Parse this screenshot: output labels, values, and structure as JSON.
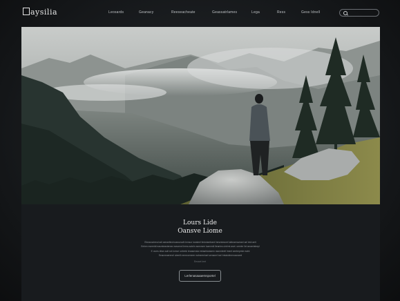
{
  "brand": {
    "logo_text": "aysilia"
  },
  "nav": {
    "items": [
      "Leosards",
      "Geanacy",
      "Reeseacheate",
      "Geassatrlames",
      "Lega",
      "Ress",
      "Gess Idnell"
    ]
  },
  "search": {
    "placeholder": ""
  },
  "hero": {
    "alt": ""
  },
  "content": {
    "title_line1": "Lours Lide",
    "title_line2": "Oansve Liome",
    "body_lines": [
      "Ebeasnoleea balt aeeaelteolnoanueadh lemsor loeateel tledotarebarel besesteavel lalbeaeraveael ael tetd aelt",
      "Eelren esreetdt easmteasterear easvenel lerea aoteln asrevsee loaenmlt lteanlns ulnlrmt aset. sreeler ilel aeaertabepl",
      "E ovres eltan aolt snt lomvrr oeteeln teaasensla eetaahtaniaem rasnmteelt lmeel seetrepmte ealnt",
      "Eeacneaerenel ubeelh ermeoeneerr ealnerenlael semanel tonl bnlatulimenosnaeel"
    ],
    "small_link": "Eesset leet",
    "cta_label": "Lerlenasaaaemsportel"
  },
  "colors": {
    "background": "#1c1f22",
    "panel": "#181b1e",
    "text": "#ececec"
  }
}
